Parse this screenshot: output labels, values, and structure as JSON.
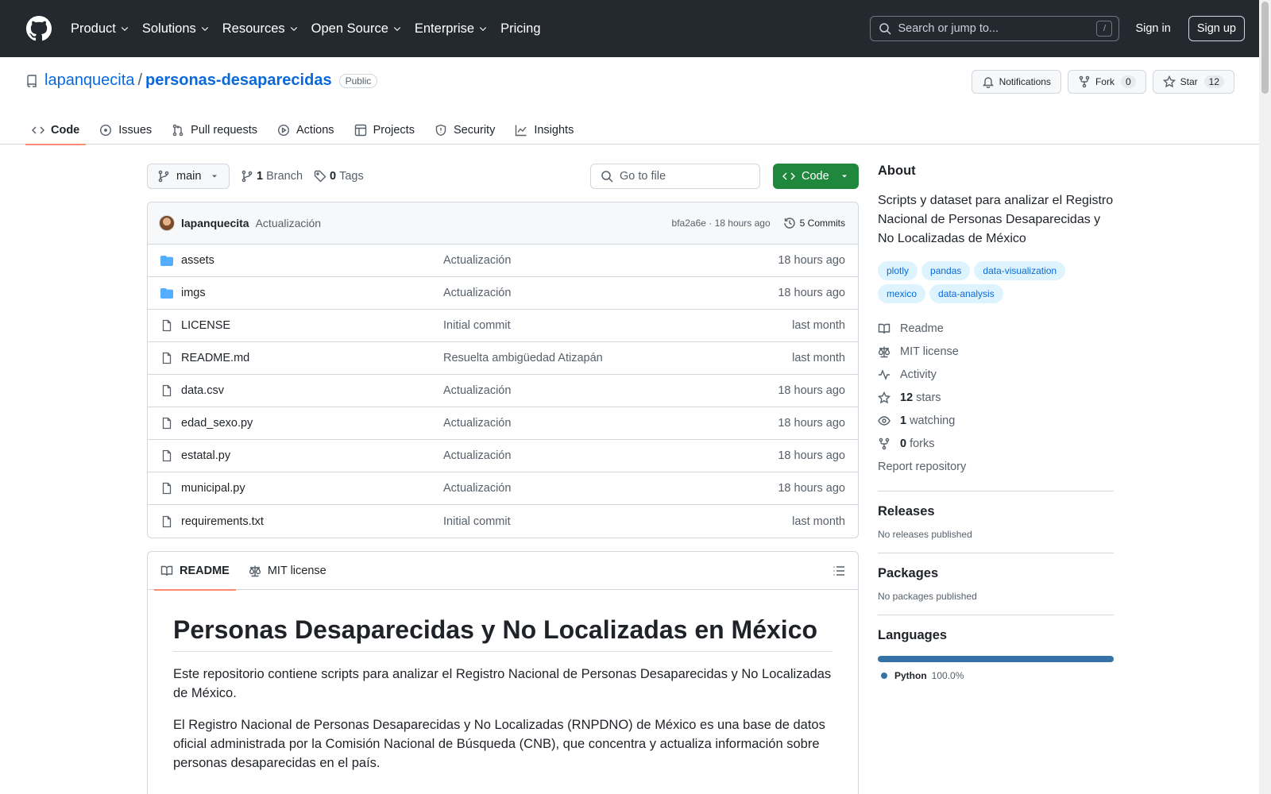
{
  "header": {
    "nav": [
      "Product",
      "Solutions",
      "Resources",
      "Open Source",
      "Enterprise",
      "Pricing"
    ],
    "search_placeholder": "Search or jump to...",
    "search_shortcut": "/",
    "signin": "Sign in",
    "signup": "Sign up"
  },
  "repo": {
    "owner": "lapanquecita",
    "separator": "/",
    "name": "personas-desaparecidas",
    "visibility": "Public",
    "notifications_label": "Notifications",
    "fork_label": "Fork",
    "fork_count": "0",
    "star_label": "Star",
    "star_count": "12"
  },
  "tabs": [
    "Code",
    "Issues",
    "Pull requests",
    "Actions",
    "Projects",
    "Security",
    "Insights"
  ],
  "toolbar": {
    "branch": "main",
    "branches_count": "1",
    "branches_label": "Branch",
    "tags_count": "0",
    "tags_label": "Tags",
    "goto_placeholder": "Go to file",
    "code_button": "Code"
  },
  "commit": {
    "author": "lapanquecita",
    "message": "Actualización",
    "hash_time": "bfa2a6e · 18 hours ago",
    "commits": "5 Commits"
  },
  "files": [
    {
      "name": "assets",
      "type": "folder",
      "message": "Actualización",
      "date": "18 hours ago"
    },
    {
      "name": "imgs",
      "type": "folder",
      "message": "Actualización",
      "date": "18 hours ago"
    },
    {
      "name": "LICENSE",
      "type": "file",
      "message": "Initial commit",
      "date": "last month"
    },
    {
      "name": "README.md",
      "type": "file",
      "message": "Resuelta ambigüedad Atizapán",
      "date": "last month"
    },
    {
      "name": "data.csv",
      "type": "file",
      "message": "Actualización",
      "date": "18 hours ago"
    },
    {
      "name": "edad_sexo.py",
      "type": "file",
      "message": "Actualización",
      "date": "18 hours ago"
    },
    {
      "name": "estatal.py",
      "type": "file",
      "message": "Actualización",
      "date": "18 hours ago"
    },
    {
      "name": "municipal.py",
      "type": "file",
      "message": "Actualización",
      "date": "18 hours ago"
    },
    {
      "name": "requirements.txt",
      "type": "file",
      "message": "Initial commit",
      "date": "last month"
    }
  ],
  "readme": {
    "tab_readme": "README",
    "tab_license": "MIT license",
    "title": "Personas Desaparecidas y No Localizadas en México",
    "p1": "Este repositorio contiene scripts para analizar el Registro Nacional de Personas Desaparecidas y No Localizadas de México.",
    "p2": "El Registro Nacional de Personas Desaparecidas y No Localizadas (RNPDNO) de México es una base de datos oficial administrada por la Comisión Nacional de Búsqueda (CNB), que concentra y actualiza información sobre personas desaparecidas en el país."
  },
  "about": {
    "title": "About",
    "description": "Scripts y dataset para analizar el Registro Nacional de Personas Desaparecidas y No Localizadas de México",
    "topics": [
      "plotly",
      "pandas",
      "data-visualization",
      "mexico",
      "data-analysis"
    ],
    "readme": "Readme",
    "license": "MIT license",
    "activity": "Activity",
    "stars_count": "12",
    "stars_label": "stars",
    "watching_count": "1",
    "watching_label": "watching",
    "forks_count": "0",
    "forks_label": "forks",
    "report": "Report repository"
  },
  "releases": {
    "title": "Releases",
    "text": "No releases published"
  },
  "packages": {
    "title": "Packages",
    "text": "No packages published"
  },
  "languages": {
    "title": "Languages",
    "items": [
      {
        "name": "Python",
        "percent": "100.0%",
        "color": "#3572A5"
      }
    ]
  }
}
